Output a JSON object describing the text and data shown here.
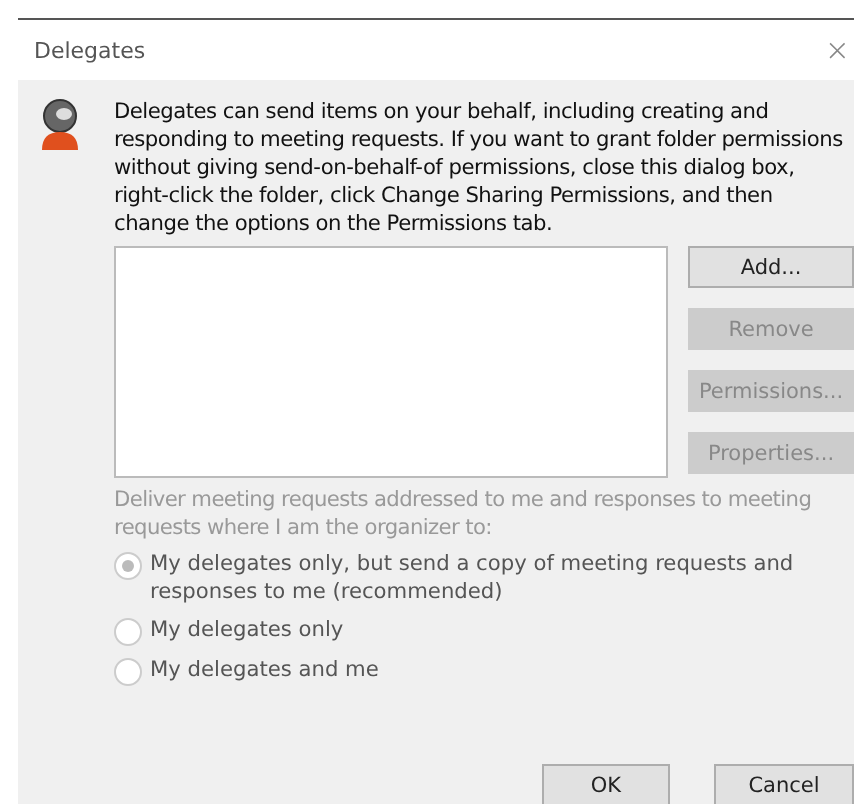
{
  "window": {
    "title": "Delegates",
    "close": "×"
  },
  "message": "Delegates can send items on your behalf, including creating and responding to meeting requests. If you want to grant folder permissions without giving send-on-behalf-of permissions, close this dialog box, right-click the folder, click Change Sharing Permissions, and then change the options on the Permissions tab.",
  "side_buttons": [
    {
      "label": "Add...",
      "disabled": false
    },
    {
      "label": "Remove",
      "disabled": true
    },
    {
      "label": "Permissions...",
      "disabled": true
    },
    {
      "label": "Properties...",
      "disabled": true
    }
  ],
  "deliver": {
    "label": "Deliver meeting requests addressed to me and responses to meeting requests where I am the organizer to:",
    "disabled": true,
    "options": [
      {
        "label": "My delegates only, but send a copy of meeting requests and responses to me (recommended)",
        "selected": true,
        "disabled": true
      },
      {
        "label": "My delegates only",
        "selected": false,
        "disabled": true
      },
      {
        "label": "My delegates and me",
        "selected": false,
        "disabled": true
      }
    ]
  },
  "buttons": [
    {
      "label": "OK"
    },
    {
      "label": "Cancel"
    }
  ]
}
